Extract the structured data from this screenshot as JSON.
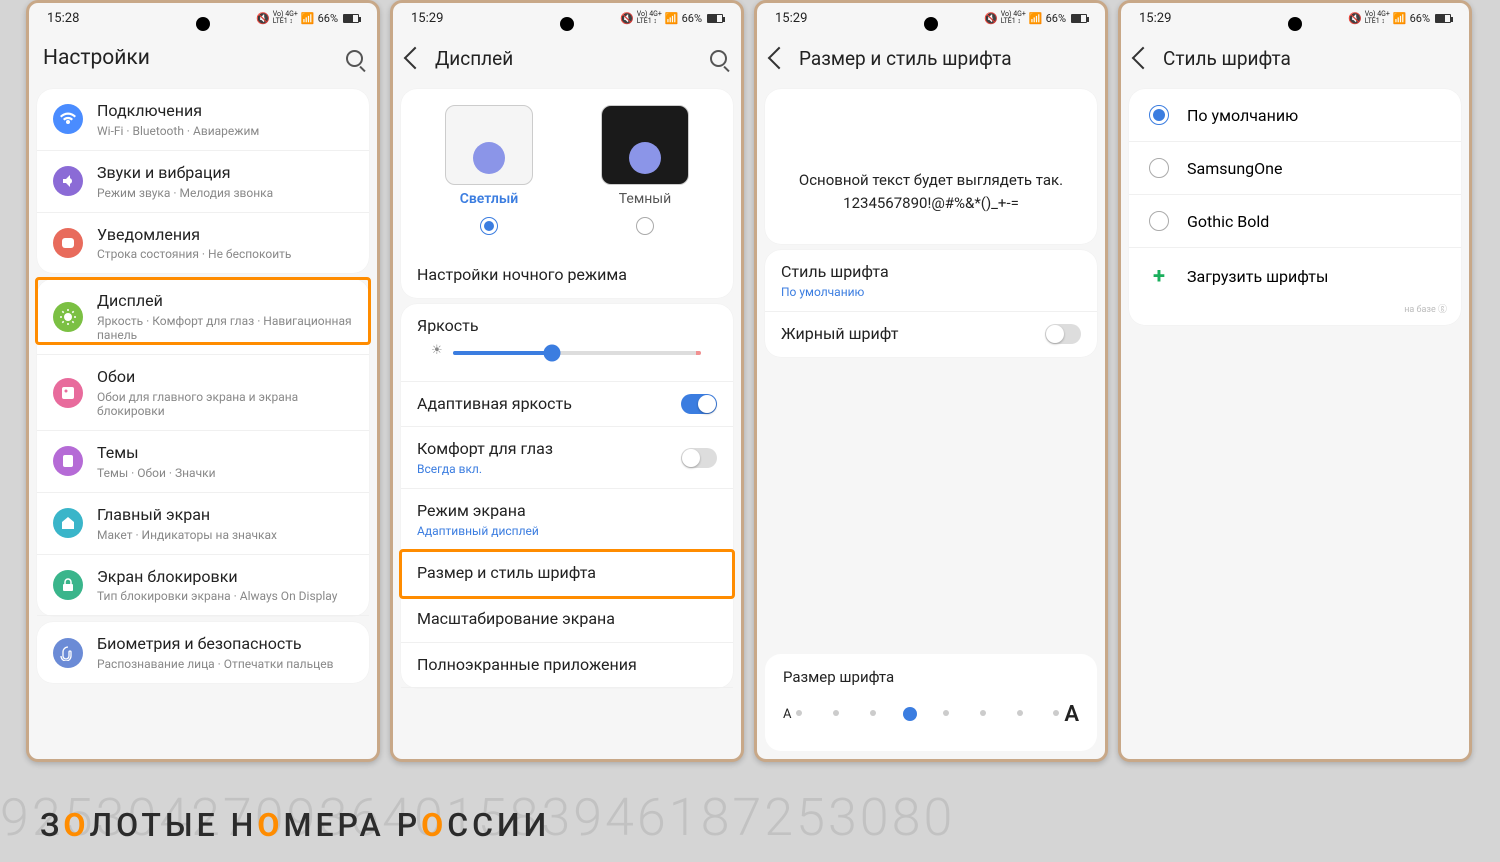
{
  "status": {
    "battery": "66%",
    "net": "Vo) 4G+\nLTE1 ↕"
  },
  "phones": [
    {
      "time": "15:28",
      "title": "Настройки",
      "items": [
        {
          "icon": "wifi",
          "color": "#4a8cff",
          "t": "Подключения",
          "s": "Wi-Fi · Bluetooth · Авиарежим"
        },
        {
          "icon": "sound",
          "color": "#8b6bd6",
          "t": "Звуки и вибрация",
          "s": "Режим звука · Мелодия звонка"
        },
        {
          "icon": "notif",
          "color": "#e86b5c",
          "t": "Уведомления",
          "s": "Строка состояния · Не беспокоить"
        },
        {
          "icon": "display",
          "color": "#7bc043",
          "t": "Дисплей",
          "s": "Яркость · Комфорт для глаз · Навигационная панель",
          "hl": true
        },
        {
          "icon": "wall",
          "color": "#e86b9c",
          "t": "Обои",
          "s": "Обои для главного экрана и экрана блокировки"
        },
        {
          "icon": "theme",
          "color": "#b56bd6",
          "t": "Темы",
          "s": "Темы · Обои · Значки"
        },
        {
          "icon": "home",
          "color": "#3ab5c9",
          "t": "Главный экран",
          "s": "Макет · Индикаторы на значках"
        },
        {
          "icon": "lock",
          "color": "#3ab58b",
          "t": "Экран блокировки",
          "s": "Тип блокировки экрана · Always On Display"
        },
        {
          "icon": "bio",
          "color": "#6b8bd6",
          "t": "Биометрия и безопасность",
          "s": "Распознавание лица · Отпечатки пальцев"
        }
      ]
    },
    {
      "time": "15:29",
      "title": "Дисплей",
      "themes": {
        "light": "Светлый",
        "dark": "Темный"
      },
      "night": "Настройки ночного режима",
      "brightness": "Яркость",
      "items": [
        {
          "t": "Адаптивная яркость",
          "toggle": true,
          "on": true
        },
        {
          "t": "Комфорт для глаз",
          "s": "Всегда вкл.",
          "link": true,
          "toggle": true,
          "on": false
        },
        {
          "t": "Режим экрана",
          "s": "Адаптивный дисплей",
          "link": true
        },
        {
          "t": "Размер и стиль шрифта",
          "hl": true
        },
        {
          "t": "Масштабирование экрана"
        },
        {
          "t": "Полноэкранные приложения"
        }
      ]
    },
    {
      "time": "15:29",
      "title": "Размер и стиль шрифта",
      "sample1": "Основной текст будет выглядеть так.",
      "sample2": "1234567890!@#%&*()_+-=",
      "items": [
        {
          "t": "Стиль шрифта",
          "s": "По умолчанию",
          "link": true
        },
        {
          "t": "Жирный шрифт",
          "toggle": true,
          "on": false
        }
      ],
      "fs": "Размер шрифта"
    },
    {
      "time": "15:29",
      "title": "Стиль шрифта",
      "radios": [
        {
          "t": "По умолчанию",
          "sel": true
        },
        {
          "t": "SamsungOne"
        },
        {
          "t": "Gothic Bold"
        }
      ],
      "download": "Загрузить шрифты",
      "powered": "на базе ⓖ"
    }
  ],
  "logo": {
    "z": "З",
    "o": "О",
    "rest1": "ЛОТЫЕ Н",
    "rest2": "МЕРА Р",
    "rest3": "ССИИ"
  },
  "bg": "925304270936401583946187253080"
}
